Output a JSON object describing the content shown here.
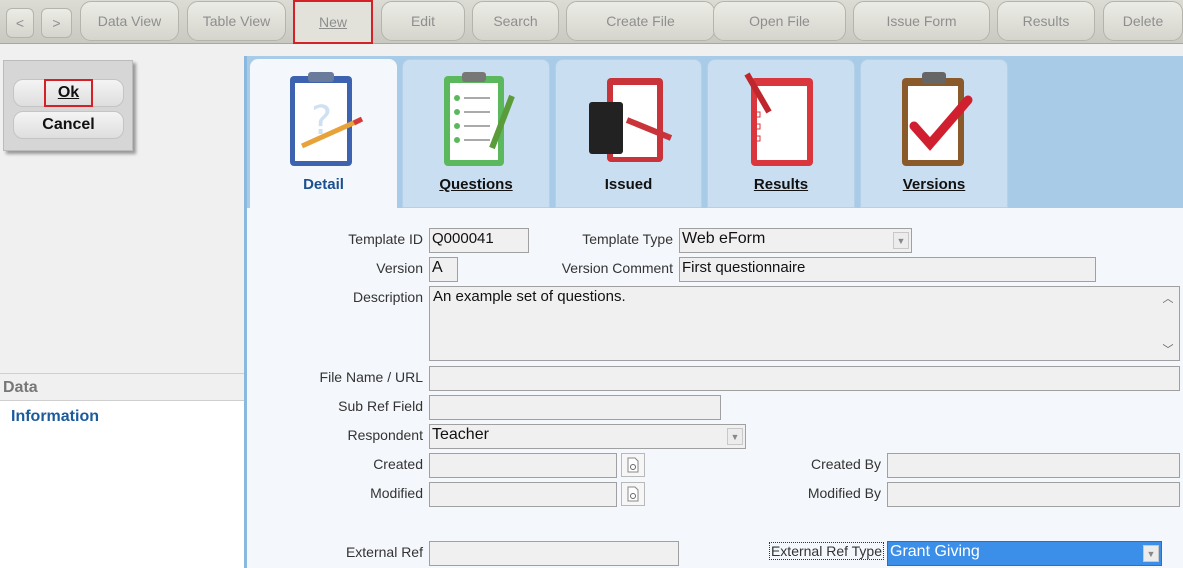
{
  "toolbar": {
    "prev": "<",
    "next": ">",
    "data_view": "Data View",
    "table_view": "Table View",
    "new": "New",
    "edit": "Edit",
    "search": "Search",
    "create_file": "Create File",
    "open_file": "Open File",
    "issue_form": "Issue Form",
    "results": "Results",
    "delete": "Delete"
  },
  "dialog": {
    "ok": "Ok",
    "cancel": "Cancel"
  },
  "sidebar": {
    "section": "Data",
    "item": "Information"
  },
  "tabs": [
    {
      "label": "Detail",
      "icon": "clipboard-pencil-icon",
      "active": true
    },
    {
      "label": "Questions",
      "icon": "checklist-icon"
    },
    {
      "label": "Issued",
      "icon": "notebook-pen-icon"
    },
    {
      "label": "Results",
      "icon": "results-checklist-icon"
    },
    {
      "label": "Versions",
      "icon": "clipboard-check-icon"
    }
  ],
  "form": {
    "template_id_label": "Template ID",
    "template_id": "Q000041",
    "template_type_label": "Template Type",
    "template_type": "Web eForm",
    "version_label": "Version",
    "version": "A",
    "version_comment_label": "Version Comment",
    "version_comment": "First questionnaire",
    "description_label": "Description",
    "description": "An example set of questions.",
    "file_name_label": "File Name / URL",
    "file_name": "",
    "sub_ref_label": "Sub Ref Field",
    "sub_ref": "",
    "respondent_label": "Respondent",
    "respondent": "Teacher",
    "created_label": "Created",
    "created": "",
    "created_by_label": "Created By",
    "created_by": "",
    "modified_label": "Modified",
    "modified": "",
    "modified_by_label": "Modified By",
    "modified_by": "",
    "external_ref_label": "External Ref",
    "external_ref": "",
    "external_ref_type_label": "External Ref Type",
    "external_ref_type": "Grant Giving"
  },
  "colors": {
    "accent": "#1b5a9c",
    "highlight": "#d42027",
    "tab_strip": "#a8cbe8",
    "selection": "#3b8fe8"
  }
}
